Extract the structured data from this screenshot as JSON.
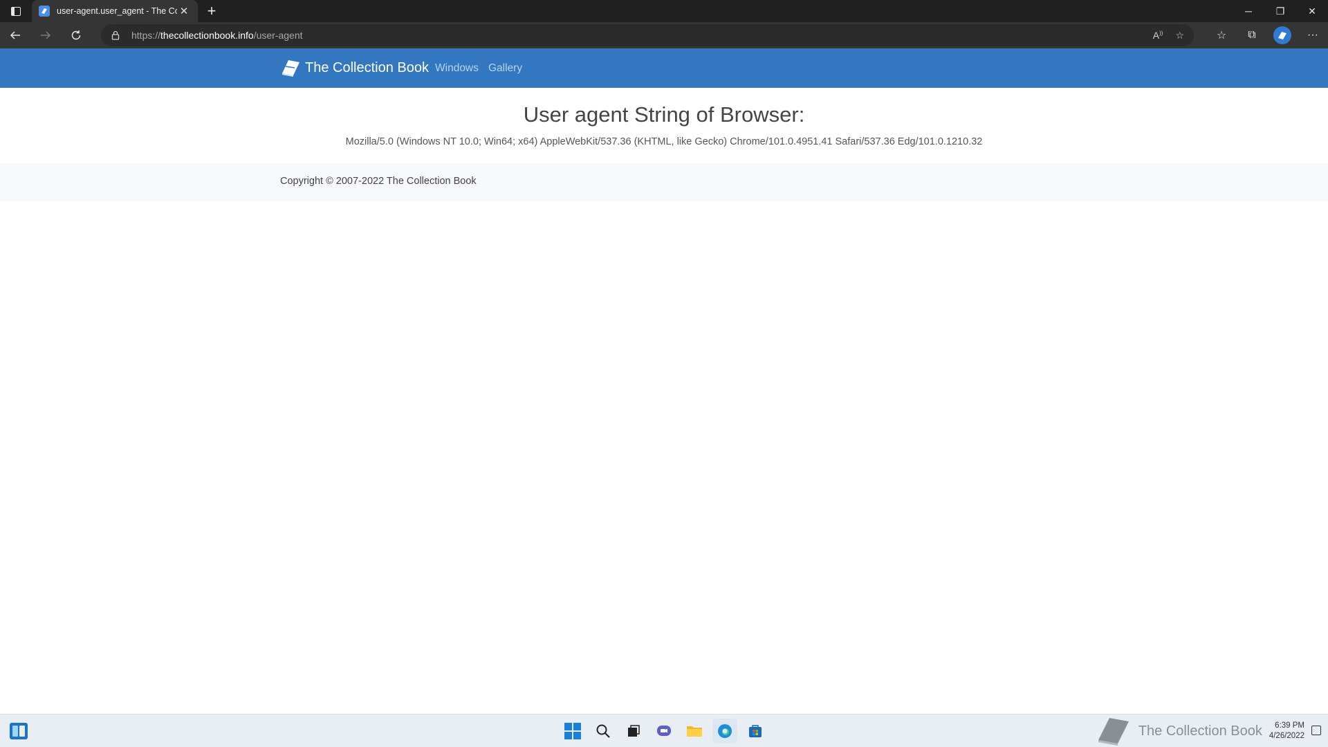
{
  "browser": {
    "tab_title": "user-agent.user_agent - The Coll",
    "url_scheme": "https://",
    "url_host": "thecollectionbook.info",
    "url_path": "/user-agent",
    "window_controls": {
      "minimize": "─",
      "restore": "❐",
      "close": "✕"
    }
  },
  "site": {
    "brand": "The Collection Book",
    "nav": [
      {
        "label": "Windows"
      },
      {
        "label": "Gallery"
      }
    ],
    "heading": "User agent String of Browser:",
    "user_agent": "Mozilla/5.0 (Windows NT 10.0; Win64; x64) AppleWebKit/537.36 (KHTML, like Gecko) Chrome/101.0.4951.41 Safari/537.36 Edg/101.0.1210.32",
    "copyright": "Copyright © 2007-2022 The Collection Book"
  },
  "taskbar": {
    "watermark": "The Collection Book",
    "time": "6:39 PM",
    "date": "4/26/2022"
  },
  "colors": {
    "navbar": "#3277bf",
    "nav_link": "#b9d3ee",
    "chrome_dark": "#202020",
    "chrome_toolbar": "#353535"
  }
}
